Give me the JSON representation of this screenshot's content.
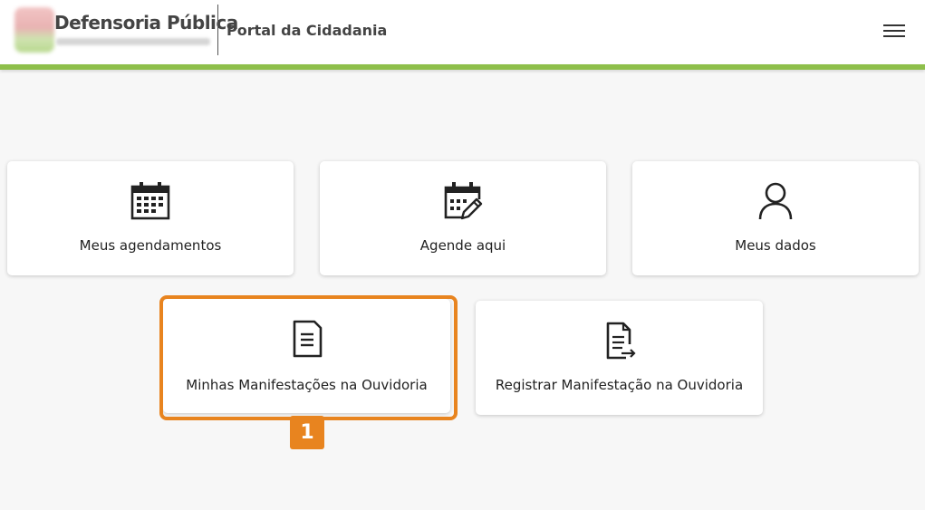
{
  "header": {
    "logo_title": "Defensoria Pública",
    "portal_title": "Portal da Cidadania",
    "menu_icon": "hamburger-menu-icon"
  },
  "colors": {
    "accent_bar": "#8ebf4b",
    "highlight": "#e8841f"
  },
  "cards": [
    {
      "label": "Meus agendamentos",
      "icon": "calendar-icon"
    },
    {
      "label": "Agende aqui",
      "icon": "calendar-edit-icon"
    },
    {
      "label": "Meus dados",
      "icon": "user-icon"
    },
    {
      "label": "Minhas Manifestações na Ouvidoria",
      "icon": "document-icon"
    },
    {
      "label": "Registrar Manifestação na Ouvidoria",
      "icon": "document-export-icon"
    }
  ],
  "highlight_badge": "1"
}
